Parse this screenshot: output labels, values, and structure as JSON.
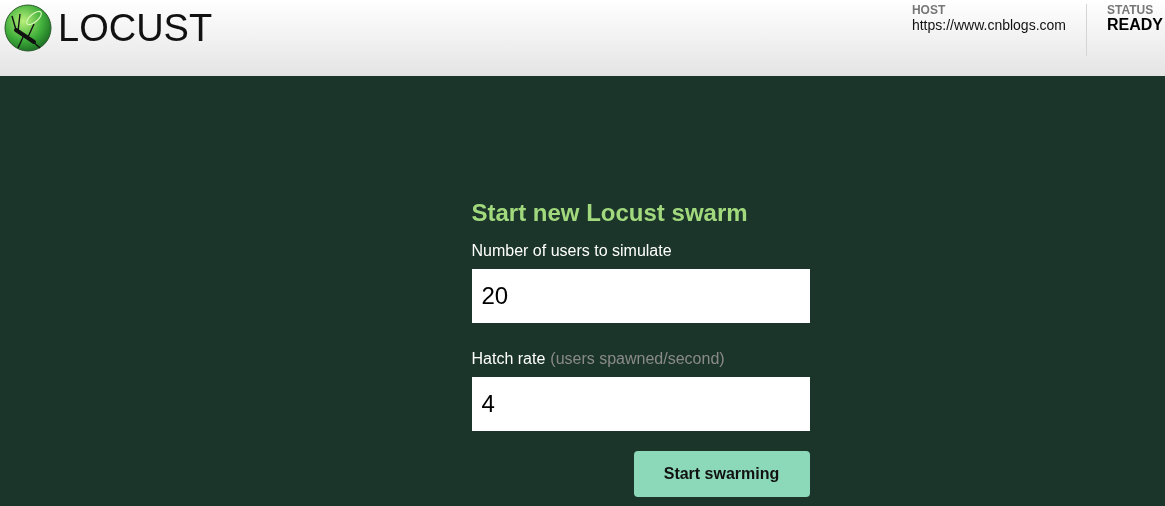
{
  "header": {
    "logo_text": "LOCUST",
    "host": {
      "label": "HOST",
      "value": "https://www.cnblogs.com"
    },
    "status": {
      "label": "STATUS",
      "value": "READY"
    }
  },
  "form": {
    "title": "Start new Locust swarm",
    "fields": [
      {
        "label": "Number of users to simulate",
        "value": "20"
      },
      {
        "label": "Hatch rate",
        "hint": "(users spawned/second)",
        "value": "4"
      }
    ],
    "submit": "Start swarming"
  }
}
